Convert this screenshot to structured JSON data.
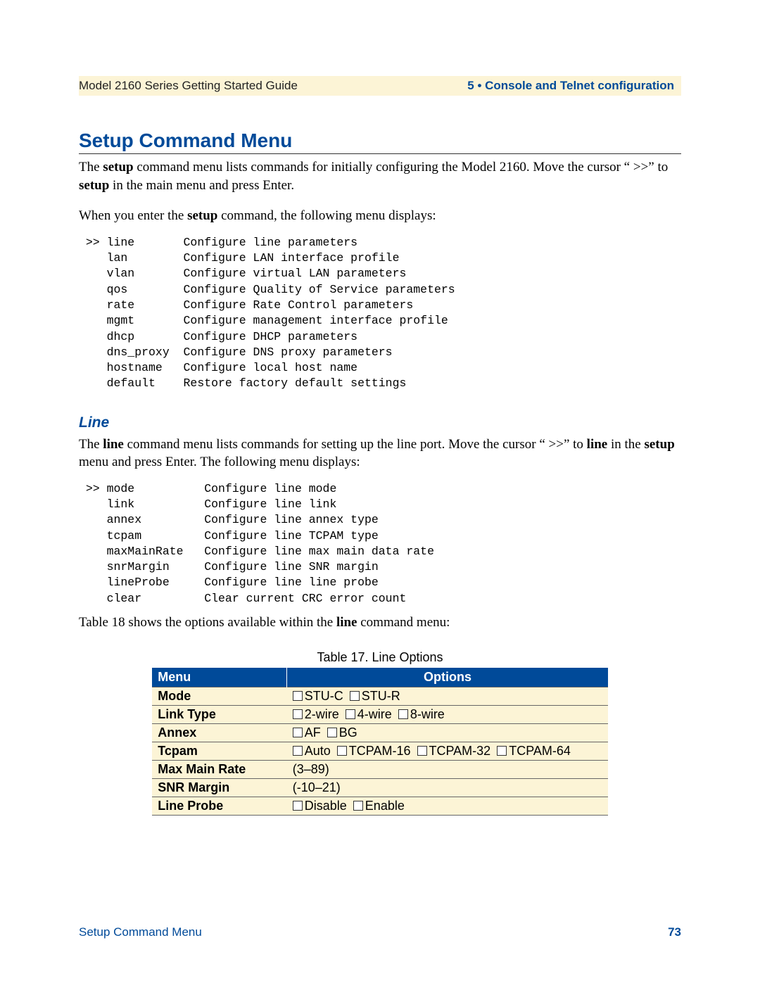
{
  "header": {
    "left": "Model 2160 Series Getting Started Guide",
    "right": "5 • Console and Telnet configuration"
  },
  "section_title": "Setup Command Menu",
  "intro": {
    "p1_pre": "The ",
    "p1_b1": "setup",
    "p1_mid": " command menu lists commands for initially configuring the Model 2160. Move the cursor “ >>” to ",
    "p1_b2": "setup",
    "p1_post": " in the main menu and press Enter.",
    "p2_pre": "When you enter the ",
    "p2_b": "setup",
    "p2_post": " command, the following menu displays:"
  },
  "setup_menu": [
    {
      "pfx": ">>",
      "cmd": "line",
      "desc": "Configure line parameters"
    },
    {
      "pfx": "  ",
      "cmd": "lan",
      "desc": "Configure LAN interface profile"
    },
    {
      "pfx": "  ",
      "cmd": "vlan",
      "desc": "Configure virtual LAN parameters"
    },
    {
      "pfx": "  ",
      "cmd": "qos",
      "desc": "Configure Quality of Service parameters"
    },
    {
      "pfx": "  ",
      "cmd": "rate",
      "desc": "Configure Rate Control parameters"
    },
    {
      "pfx": "  ",
      "cmd": "mgmt",
      "desc": "Configure management interface profile"
    },
    {
      "pfx": "  ",
      "cmd": "dhcp",
      "desc": "Configure DHCP parameters"
    },
    {
      "pfx": "  ",
      "cmd": "dns_proxy",
      "desc": "Configure DNS proxy parameters"
    },
    {
      "pfx": "  ",
      "cmd": "hostname",
      "desc": "Configure local host name"
    },
    {
      "pfx": "  ",
      "cmd": "default",
      "desc": "Restore factory default settings"
    }
  ],
  "line_heading": "Line",
  "line_intro": {
    "pre": "The ",
    "b1": "line",
    "mid1": " command menu lists commands for setting up the line port. Move the cursor “ >>” to ",
    "b2": "line",
    "mid2": " in the ",
    "b3": "setup",
    "post": " menu and press Enter. The following menu displays:"
  },
  "line_menu": [
    {
      "pfx": ">>",
      "cmd": "mode",
      "desc": "Configure line mode"
    },
    {
      "pfx": "  ",
      "cmd": "link",
      "desc": "Configure line link"
    },
    {
      "pfx": "  ",
      "cmd": "annex",
      "desc": "Configure line annex type"
    },
    {
      "pfx": "  ",
      "cmd": "tcpam",
      "desc": "Configure line TCPAM type"
    },
    {
      "pfx": "  ",
      "cmd": "maxMainRate",
      "desc": "Configure line max main data rate"
    },
    {
      "pfx": "  ",
      "cmd": "snrMargin",
      "desc": "Configure line SNR margin"
    },
    {
      "pfx": "  ",
      "cmd": "lineProbe",
      "desc": "Configure line line probe"
    },
    {
      "pfx": "  ",
      "cmd": "clear",
      "desc": "Clear current CRC error count"
    }
  ],
  "post_line_menu": {
    "pre": "Table 18 shows the options available within the ",
    "b": "line",
    "post": " command menu:"
  },
  "table_caption": "Table 17. Line Options",
  "table": {
    "head_menu": "Menu",
    "head_options": "Options",
    "rows": [
      {
        "menu": "Mode",
        "type": "checks",
        "opts": [
          "STU-C",
          "STU-R"
        ]
      },
      {
        "menu": "Link Type",
        "type": "checks",
        "opts": [
          "2-wire",
          "4-wire",
          "8-wire"
        ]
      },
      {
        "menu": "Annex",
        "type": "checks",
        "opts": [
          "AF",
          "BG"
        ]
      },
      {
        "menu": "Tcpam",
        "type": "checks",
        "opts": [
          "Auto",
          "TCPAM-16",
          "TCPAM-32",
          "TCPAM-64"
        ]
      },
      {
        "menu": "Max Main Rate",
        "type": "text",
        "text": "(3–89)"
      },
      {
        "menu": "SNR Margin",
        "type": "text",
        "text": "(-10–21)"
      },
      {
        "menu": "Line Probe",
        "type": "checks",
        "opts": [
          "Disable",
          "Enable"
        ]
      }
    ]
  },
  "footer": {
    "left": "Setup Command Menu",
    "page": "73"
  }
}
